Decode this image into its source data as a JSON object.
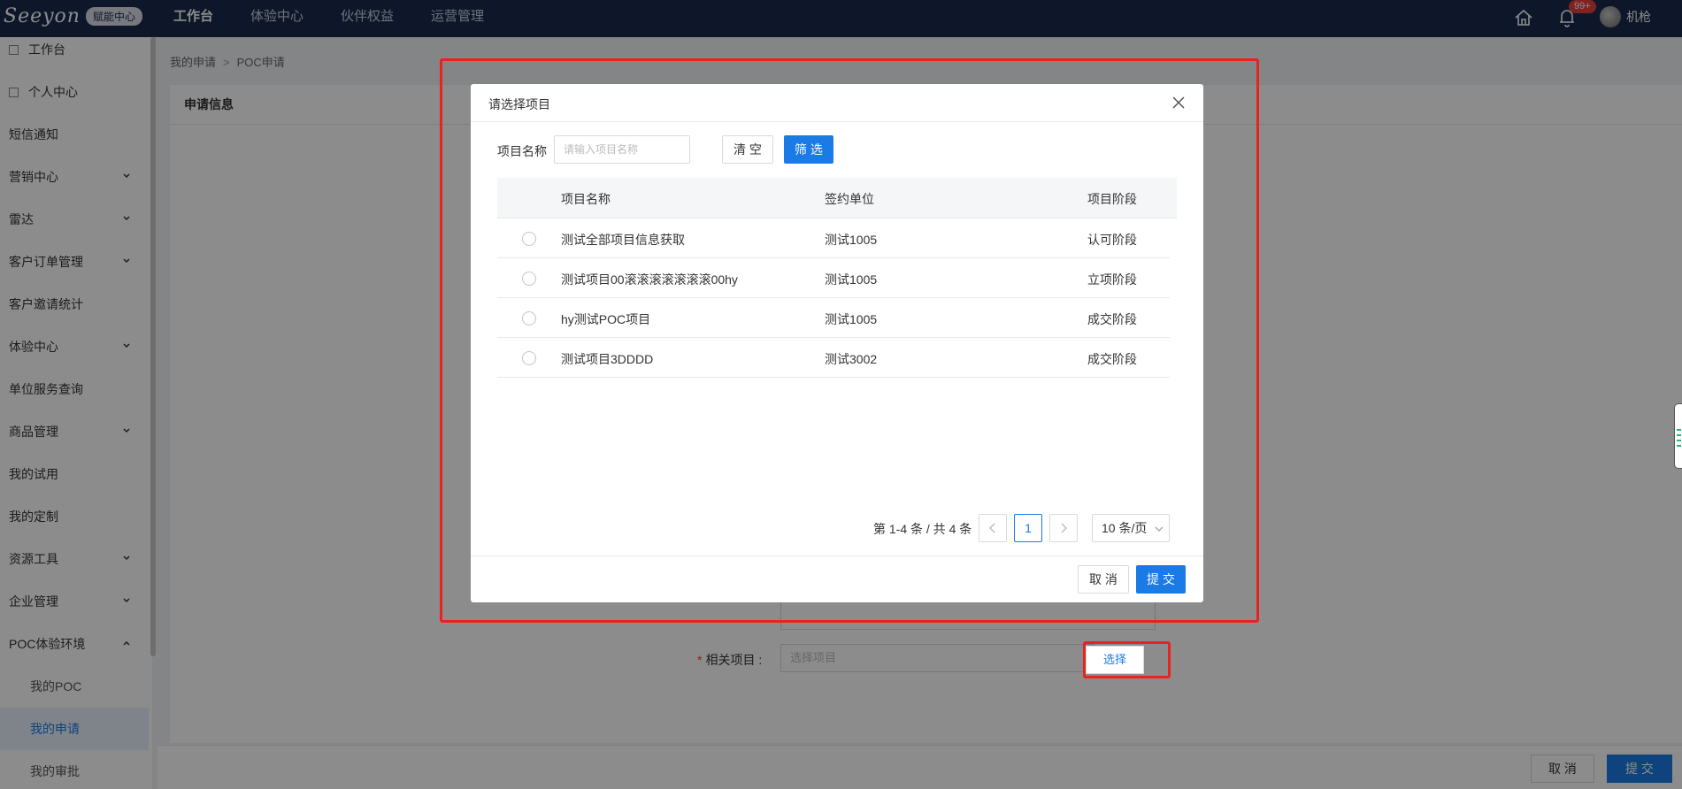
{
  "topbar": {
    "logo_text": "Seeyon",
    "logo_badge": "赋能中心",
    "nav": [
      "工作台",
      "体验中心",
      "伙伴权益",
      "运营管理"
    ],
    "badge_count": "99+",
    "username": "机枪"
  },
  "sidebar": {
    "items": [
      {
        "label": "工作台"
      },
      {
        "label": "个人中心"
      },
      {
        "label": "短信通知"
      },
      {
        "label": "营销中心"
      },
      {
        "label": "雷达"
      },
      {
        "label": "客户订单管理"
      },
      {
        "label": "客户邀请统计"
      },
      {
        "label": "体验中心"
      },
      {
        "label": "单位服务查询"
      },
      {
        "label": "商品管理"
      },
      {
        "label": "我的试用"
      },
      {
        "label": "我的定制"
      },
      {
        "label": "资源工具"
      },
      {
        "label": "企业管理"
      },
      {
        "label": "POC体验环境"
      },
      {
        "label": "我的POC"
      },
      {
        "label": "我的申请"
      },
      {
        "label": "我的审批"
      }
    ]
  },
  "breadcrumb": {
    "parent": "我的申请",
    "separator": ">",
    "current": "POC申请"
  },
  "page": {
    "card_title": "申请信息",
    "related_label": "相关项目 :",
    "related_placeholder": "选择项目",
    "select_button": "选择",
    "footer_cancel": "取 消",
    "footer_submit": "提 交"
  },
  "modal": {
    "title": "请选择项目",
    "filter_label": "项目名称",
    "filter_placeholder": "请输入项目名称",
    "clear_button": "清 空",
    "filter_button": "筛 选",
    "columns": [
      "项目名称",
      "签约单位",
      "项目阶段"
    ],
    "rows": [
      {
        "name": "测试全部项目信息获取",
        "unit": "测试1005",
        "stage": "认可阶段"
      },
      {
        "name": "测试项目00滚滚滚滚滚滚滚00hy",
        "unit": "测试1005",
        "stage": "立项阶段"
      },
      {
        "name": "hy测试POC项目",
        "unit": "测试1005",
        "stage": "成交阶段"
      },
      {
        "name": "测试项目3DDDD",
        "unit": "测试3002",
        "stage": "成交阶段"
      }
    ],
    "pagination": {
      "total": "第 1-4 条 / 共 4 条",
      "current_page": "1",
      "page_size": "10 条/页"
    },
    "cancel_button": "取 消",
    "submit_button": "提 交"
  }
}
